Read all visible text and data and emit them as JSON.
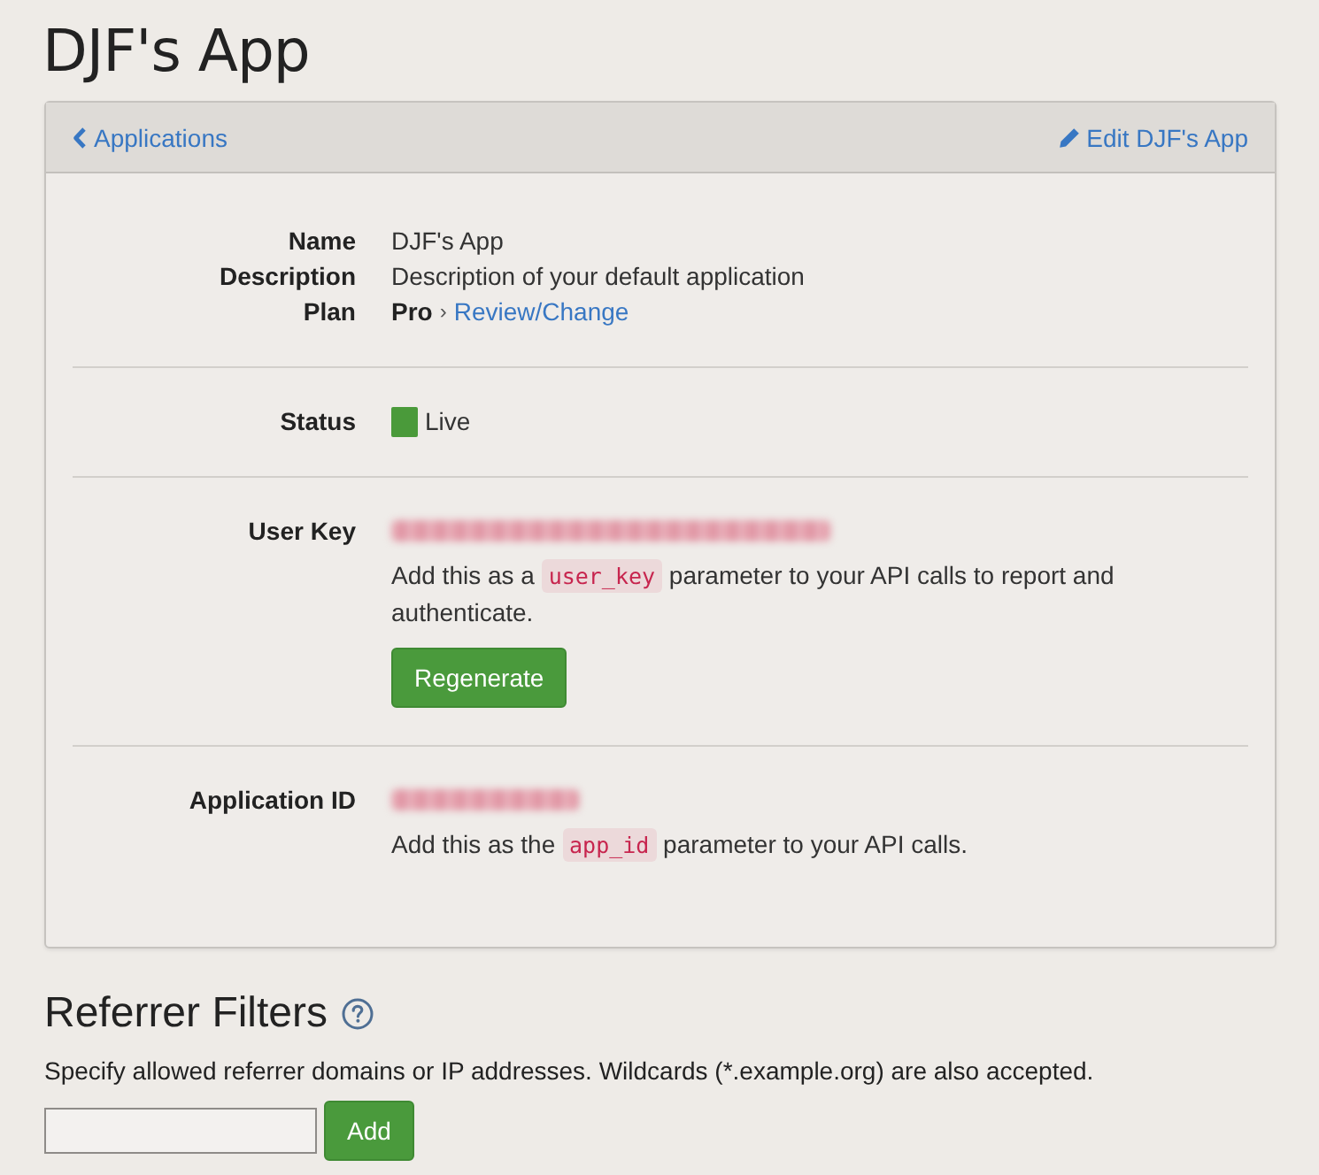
{
  "page_title": "DJF's App",
  "panel": {
    "back_link": "Applications",
    "edit_link": "Edit DJF's App",
    "sections": [
      {
        "fields": [
          {
            "kind": "text",
            "label": "Name",
            "value": "DJF's App"
          },
          {
            "kind": "text",
            "label": "Description",
            "value": "Description of your default application"
          },
          {
            "kind": "plan",
            "label": "Plan",
            "value": "Pro",
            "separator": "›",
            "link": "Review/Change"
          }
        ]
      },
      {
        "fields": [
          {
            "kind": "status",
            "label": "Status",
            "value": "Live",
            "color": "#4a9a3a"
          }
        ]
      },
      {
        "fields": [
          {
            "kind": "secret_key",
            "label": "User Key",
            "help": {
              "before": "Add this as a",
              "code": "user_key",
              "after": "parameter to your API calls to report and authenticate."
            },
            "button": "Regenerate"
          }
        ]
      },
      {
        "fields": [
          {
            "kind": "secret_id",
            "label": "Application ID",
            "help": {
              "before": "Add this as the",
              "code": "app_id",
              "after": "parameter to your API calls."
            }
          }
        ]
      }
    ]
  },
  "referrer_filters": {
    "title": "Referrer Filters",
    "description": "Specify allowed referrer domains or IP addresses. Wildcards (*.example.org) are also accepted.",
    "add_button": "Add"
  }
}
